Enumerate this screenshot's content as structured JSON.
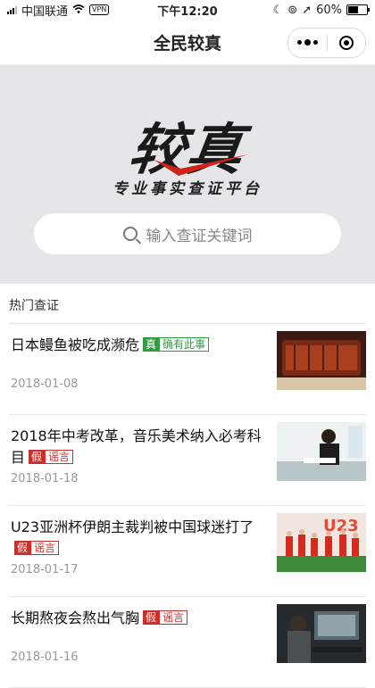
{
  "status_bar": {
    "carrier": "中国联通",
    "vpn": "VPN",
    "time": "下午12:20",
    "battery": "60%",
    "battery_level": 0.6
  },
  "navbar": {
    "title": "全民较真"
  },
  "hero": {
    "logo_text": "较真",
    "slogan": "专业事实查证平台",
    "search_placeholder": "输入查证关键词"
  },
  "section": {
    "title": "热门查证"
  },
  "items": [
    {
      "title": "日本鳗鱼被吃成濒危",
      "verdict": "真",
      "verdict_label": "确有此事",
      "date": "2018-01-08"
    },
    {
      "title": "2018年中考改革，音乐美术纳入必考科目",
      "verdict": "假",
      "verdict_label": "谣言",
      "date": "2018-01-18"
    },
    {
      "title": "U23亚洲杯伊朗主裁判被中国球迷打了",
      "verdict": "假",
      "verdict_label": "谣言",
      "date": "2018-01-17"
    },
    {
      "title": "长期熬夜会熬出气胸",
      "verdict": "假",
      "verdict_label": "谣言",
      "date": "2018-01-16"
    }
  ],
  "colors": {
    "hero_bg": "#e6e6e8",
    "true_green": "#2e9c3f",
    "false_red": "#c9302c",
    "logo_check_red": "#d0241b"
  }
}
